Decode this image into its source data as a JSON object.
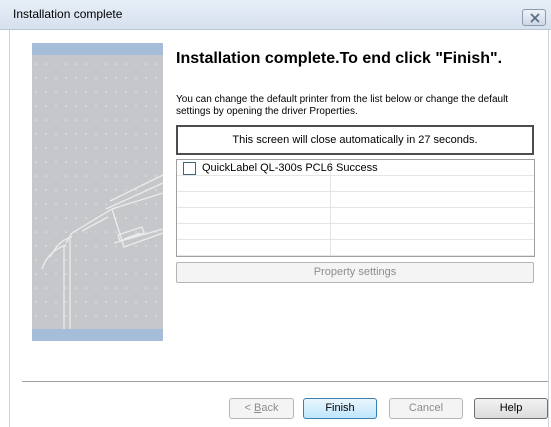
{
  "window": {
    "title": "Installation complete"
  },
  "headline": "Installation complete.To end click \"Finish\".",
  "description": "You can change the default printer from the list below or change the default settings by opening the driver Properties.",
  "countdown": "This screen will close automatically in 27 seconds.",
  "printer_list": {
    "rows": [
      {
        "name": "QuickLabel QL-300s PCL6",
        "status": "Success",
        "checked": false
      }
    ]
  },
  "property_button": "Property settings",
  "buttons": {
    "back_prefix": "< ",
    "back_mnemonic": "B",
    "back_rest": "ack",
    "finish": "Finish",
    "cancel": "Cancel",
    "help": "Help"
  },
  "colors": {
    "banner_blue": "#a6bdda",
    "banner_gray": "#c5c7cb",
    "default_button_border": "#3c7fb1"
  },
  "icons": {
    "close": "close-icon",
    "checkbox": "checkbox-icon"
  }
}
